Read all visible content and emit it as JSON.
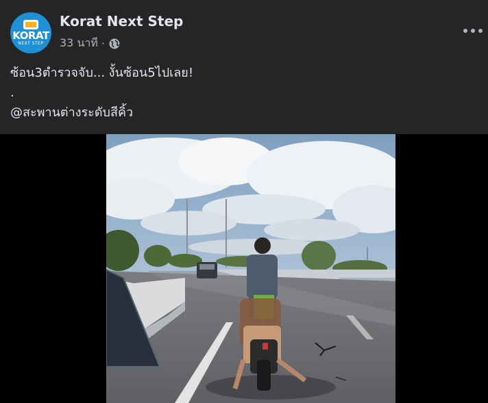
{
  "post": {
    "page_name": "Korat Next Step",
    "time": "33 นาที",
    "separator": "·",
    "privacy_icon": "globe-icon",
    "more_icon": "more-options-icon",
    "caption_lines": [
      "ซ้อน3ตำรวจจับ...  งั้นซ้อน5ไปเลย!",
      ".",
      "@สะพานต่างระดับสีคิ้ว"
    ]
  },
  "avatar": {
    "logo_text": "KORAT",
    "logo_subtext": "NEXT STEP"
  },
  "colors": {
    "header_bg": "#242526",
    "primary_text": "#e4e6eb",
    "secondary_text": "#b0b3b8",
    "brand_blue": "#1f8fd6"
  }
}
